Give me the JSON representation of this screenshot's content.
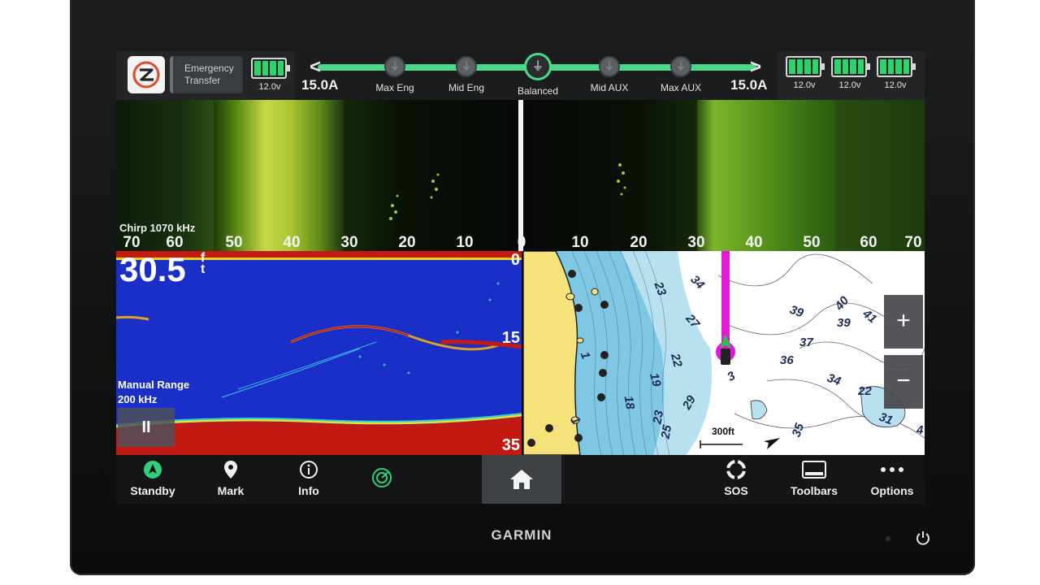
{
  "top_bar": {
    "emergency_transfer": "Emergency\nTransfer",
    "left_battery": {
      "voltage": "12.0v",
      "level": 1.0
    },
    "current_left": "15.0A",
    "current_right": "15.0A",
    "modes": [
      {
        "label": "Max Eng",
        "active": false
      },
      {
        "label": "Mid Eng",
        "active": false
      },
      {
        "label": "Balanced",
        "active": true
      },
      {
        "label": "Mid AUX",
        "active": false
      },
      {
        "label": "Max AUX",
        "active": false
      }
    ],
    "right_batteries": [
      {
        "voltage": "12.0v",
        "level": 1.0
      },
      {
        "voltage": "12.0v",
        "level": 1.0
      },
      {
        "voltage": "12.0v",
        "level": 1.0
      }
    ],
    "accent": "#49d987"
  },
  "sidevu": {
    "frequency": "Chirp 1070 kHz",
    "scale": [
      "70",
      "60",
      "50",
      "40",
      "30",
      "20",
      "10",
      "0",
      "10",
      "20",
      "30",
      "40",
      "50",
      "60",
      "70"
    ]
  },
  "sonar": {
    "depth": "30.5",
    "depth_unit": "f\nt",
    "range_top": "0",
    "range_mid": "15",
    "range_bottom": "35",
    "mode": "Manual Range",
    "freq": "200 kHz",
    "pause_label": "II"
  },
  "chart": {
    "scale": "300ft",
    "depths_inline": [
      "23",
      "34",
      "27",
      "22",
      "19",
      "18",
      "29",
      "23",
      "25",
      "1",
      "1",
      "3",
      "39",
      "40",
      "39",
      "41",
      "37",
      "36",
      "34",
      "22",
      "31",
      "35",
      "4"
    ],
    "zoom_in": "+",
    "zoom_out": "−"
  },
  "bottom_bar": {
    "standby": "Standby",
    "mark": "Mark",
    "info": "Info",
    "sos": "SOS",
    "toolbars": "Toolbars",
    "options": "Options"
  },
  "device": {
    "brand": "GARMIN"
  }
}
